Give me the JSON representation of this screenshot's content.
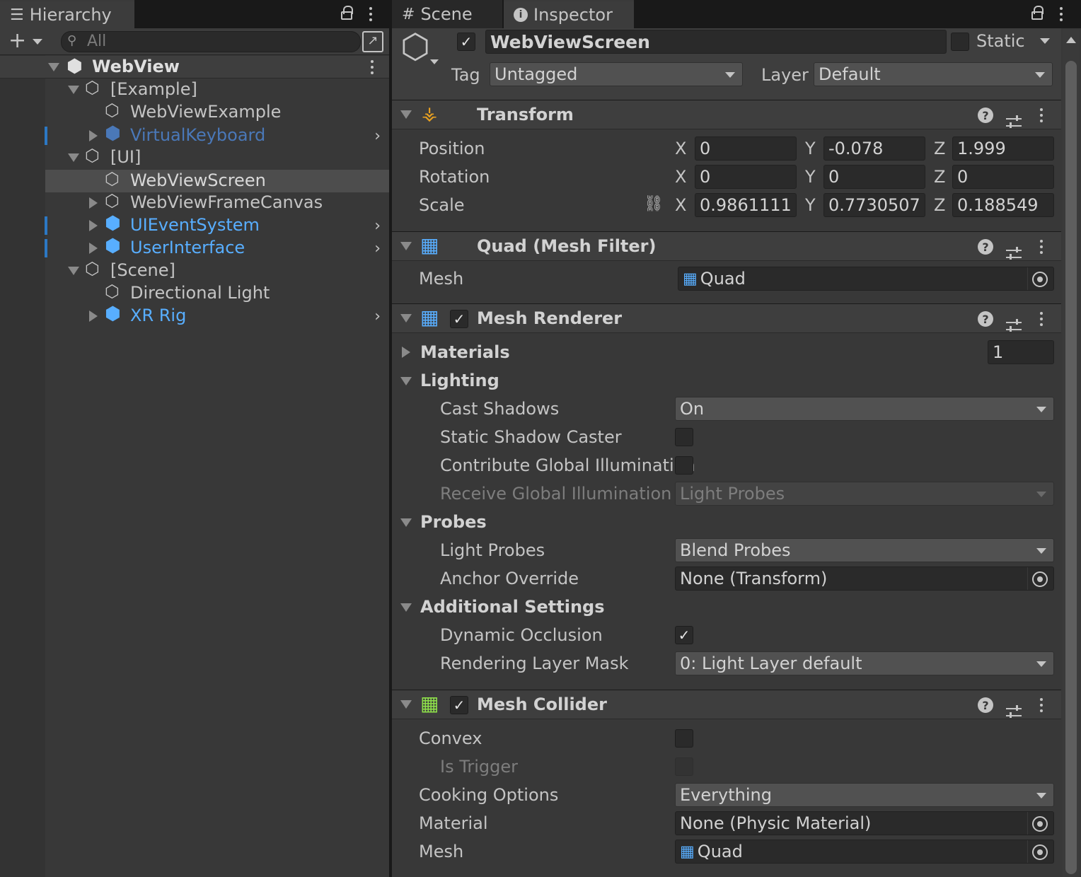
{
  "hierarchy": {
    "tab_label": "Hierarchy",
    "search_placeholder": "All",
    "scene_name": "WebView",
    "items": [
      {
        "label": "[Example]",
        "color": "#c4c4c4"
      },
      {
        "label": "WebViewExample",
        "color": "#c4c4c4"
      },
      {
        "label": "VirtualKeyboard",
        "color": "#4a78b8"
      },
      {
        "label": "[UI]",
        "color": "#c4c4c4"
      },
      {
        "label": "WebViewScreen",
        "color": "#c4c4c4"
      },
      {
        "label": "WebViewFrameCanvas",
        "color": "#c4c4c4"
      },
      {
        "label": "UIEventSystem",
        "color": "#58aeff"
      },
      {
        "label": "UserInterface",
        "color": "#58aeff"
      },
      {
        "label": "[Scene]",
        "color": "#c4c4c4"
      },
      {
        "label": "Directional Light",
        "color": "#c4c4c4"
      },
      {
        "label": "XR Rig",
        "color": "#58aeff"
      }
    ]
  },
  "tabs": {
    "scene": "Scene",
    "inspector": "Inspector"
  },
  "object": {
    "name": "WebViewScreen",
    "static_label": "Static",
    "tag_label": "Tag",
    "tag_value": "Untagged",
    "layer_label": "Layer",
    "layer_value": "Default"
  },
  "transform": {
    "title": "Transform",
    "position_label": "Position",
    "rotation_label": "Rotation",
    "scale_label": "Scale",
    "axis_x": "X",
    "axis_y": "Y",
    "axis_z": "Z",
    "position": {
      "x": "0",
      "y": "-0.078",
      "z": "1.999"
    },
    "rotation": {
      "x": "0",
      "y": "0",
      "z": "0"
    },
    "scale": {
      "x": "0.9861111",
      "y": "0.7730507",
      "z": "0.188549"
    }
  },
  "mesh_filter": {
    "title": "Quad (Mesh Filter)",
    "mesh_label": "Mesh",
    "mesh_value": "Quad"
  },
  "mesh_renderer": {
    "title": "Mesh Renderer",
    "materials_label": "Materials",
    "materials_count": "1",
    "lighting_label": "Lighting",
    "cast_shadows_label": "Cast Shadows",
    "cast_shadows_value": "On",
    "static_shadow_caster_label": "Static Shadow Caster",
    "contribute_gi_label": "Contribute Global Illumination",
    "receive_gi_label": "Receive Global Illumination",
    "receive_gi_value": "Light Probes",
    "probes_label": "Probes",
    "light_probes_label": "Light Probes",
    "light_probes_value": "Blend Probes",
    "anchor_override_label": "Anchor Override",
    "anchor_override_value": "None (Transform)",
    "additional_settings_label": "Additional Settings",
    "dynamic_occlusion_label": "Dynamic Occlusion",
    "rendering_layer_mask_label": "Rendering Layer Mask",
    "rendering_layer_mask_value": "0: Light Layer default"
  },
  "mesh_collider": {
    "title": "Mesh Collider",
    "convex_label": "Convex",
    "is_trigger_label": "Is Trigger",
    "cooking_options_label": "Cooking Options",
    "cooking_options_value": "Everything",
    "material_label": "Material",
    "material_value": "None (Physic Material)",
    "mesh_label": "Mesh",
    "mesh_value": "Quad"
  }
}
